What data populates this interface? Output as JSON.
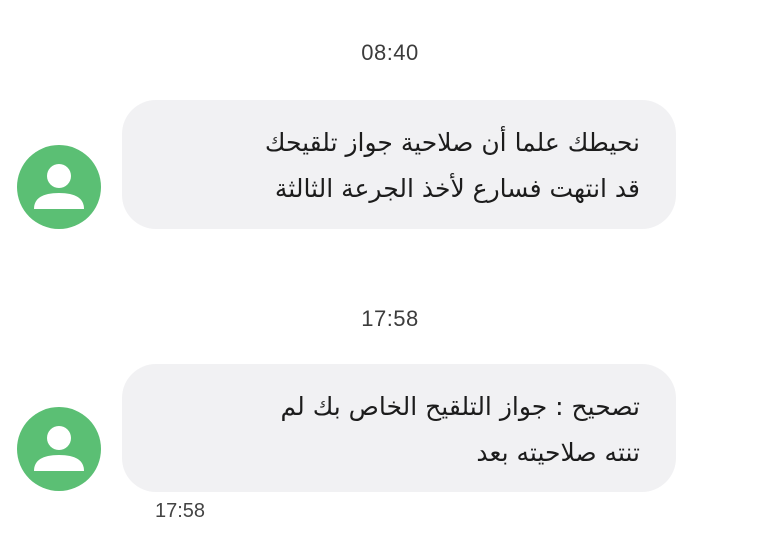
{
  "conversation": {
    "messages": [
      {
        "timestamp_header": "08:40",
        "lines": [
          "نحيطك علما أن صلاحية جواز تلقيحك",
          "قد انتهت فسارع لأخذ الجرعة الثالثة"
        ],
        "sender_avatar": "person-icon"
      },
      {
        "timestamp_header": "17:58",
        "lines": [
          "تصحيح : جواز التلقيح الخاص بك لم",
          "تنته صلاحيته بعد"
        ],
        "sender_avatar": "person-icon",
        "sent_time": "17:58"
      }
    ]
  },
  "colors": {
    "avatar_background": "#5bbf74",
    "bubble_background": "#f1f1f3",
    "text": "#1c1c1c"
  }
}
